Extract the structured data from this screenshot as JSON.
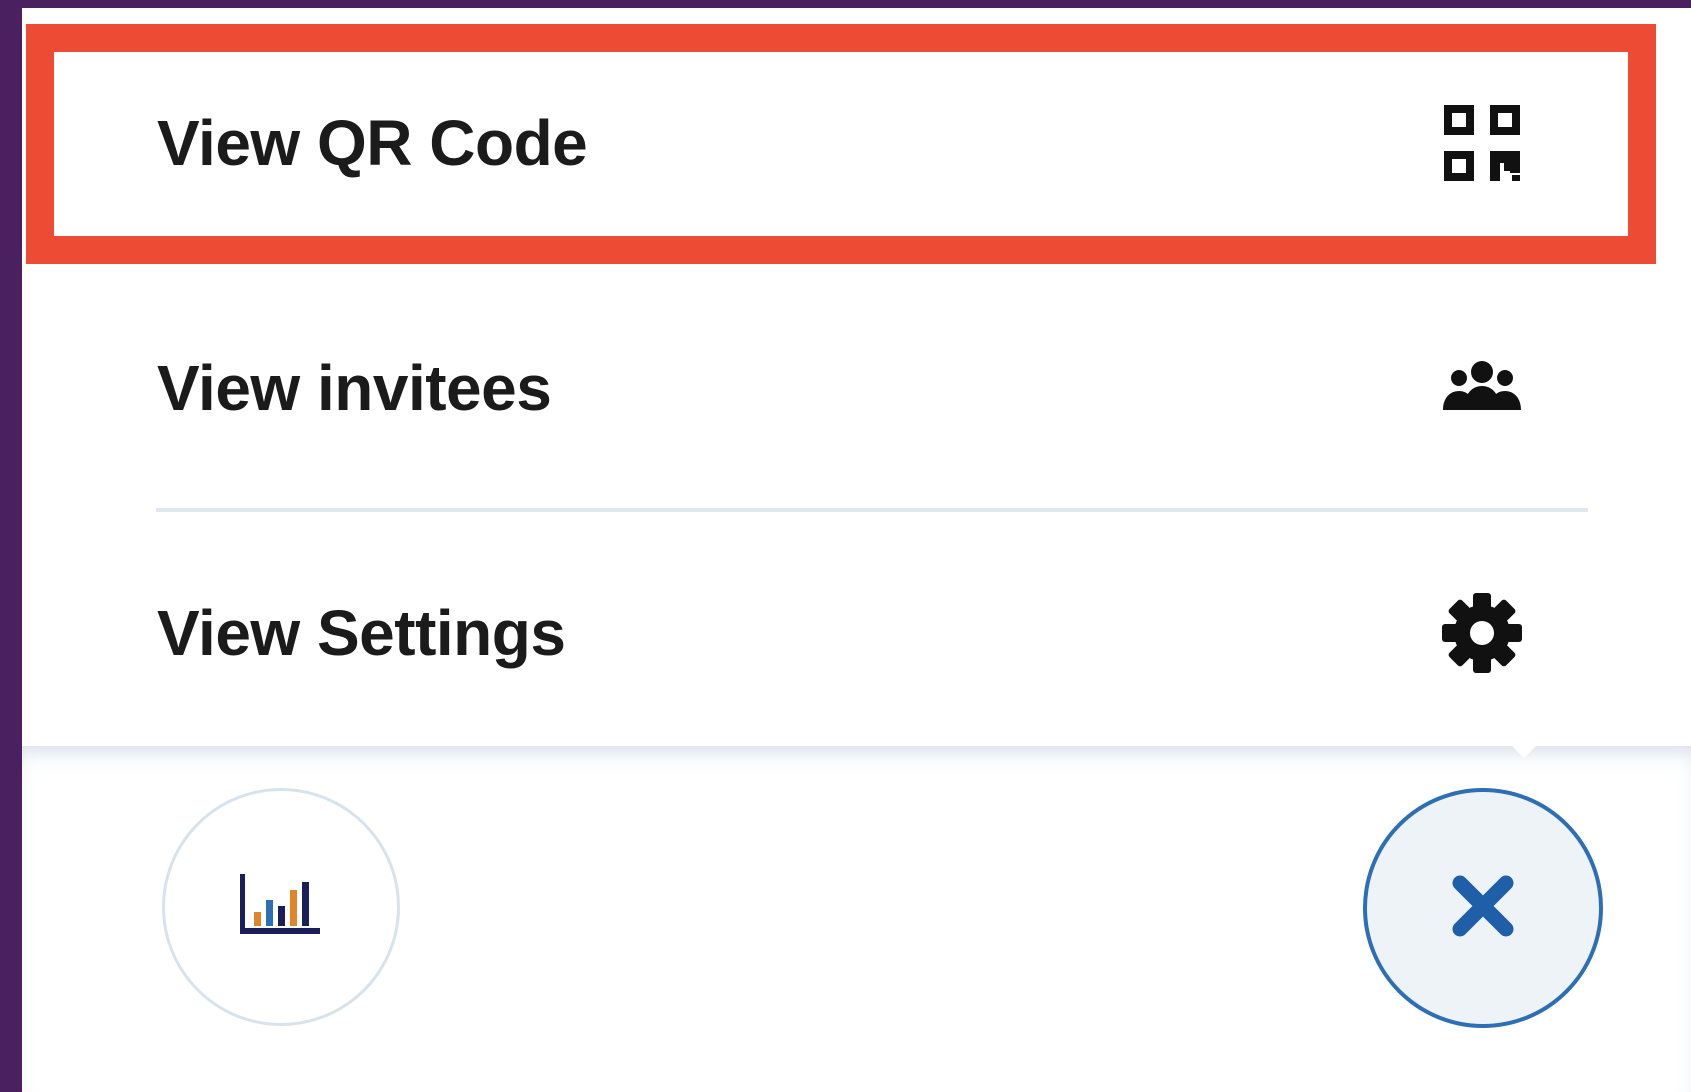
{
  "menu": {
    "items": [
      {
        "label": "View QR Code",
        "icon": "qr-code-icon",
        "highlighted": true
      },
      {
        "label": "View invitees",
        "icon": "people-group-icon",
        "highlighted": false
      },
      {
        "label": "View Settings",
        "icon": "gear-icon",
        "highlighted": false
      }
    ]
  },
  "bottom_bar": {
    "left_button_icon": "bar-chart-icon",
    "right_button_icon": "close-icon"
  },
  "colors": {
    "highlight": "#ee4b34",
    "accent": "#2d6fb6",
    "frame": "#4a2060",
    "text": "#1b1b1b"
  }
}
